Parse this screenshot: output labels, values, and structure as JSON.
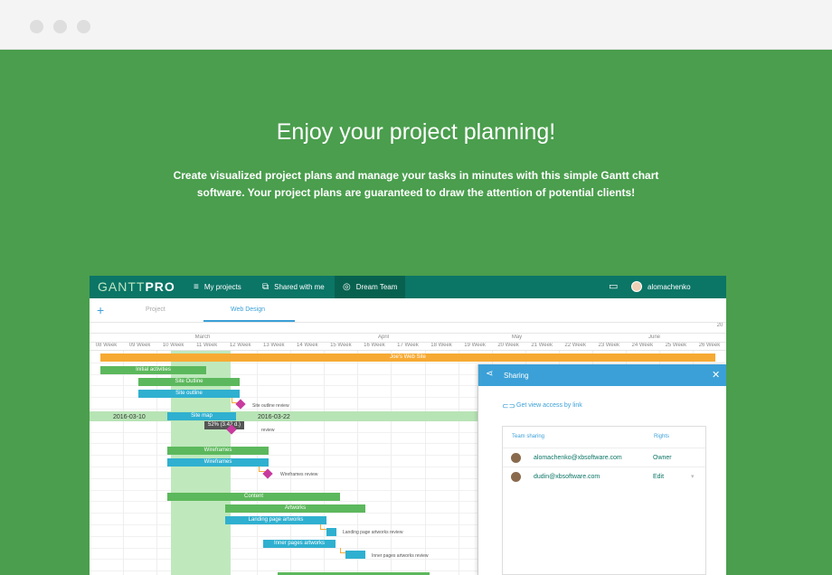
{
  "hero": {
    "title": "Enjoy your project planning!",
    "description": "Create visualized project plans and manage your tasks in minutes with this simple Gantt chart software. Your project plans are guaranteed to draw the attention of potential clients!"
  },
  "app": {
    "logo_part1": "GANTT",
    "logo_part2": "PRO",
    "nav": [
      {
        "label": "My projects",
        "icon": "list-icon"
      },
      {
        "label": "Shared with me",
        "icon": "share-edit-icon"
      },
      {
        "label": "Dream Team",
        "icon": "team-icon"
      }
    ],
    "username": "alomachenko",
    "tabs": [
      "Project",
      "Web Design"
    ],
    "months": [
      "March",
      "April",
      "May",
      "June"
    ],
    "weeks": [
      "08 Week",
      "09 Week",
      "10 Week",
      "11 Week",
      "12 Week",
      "13 Week",
      "14 Week",
      "15 Week",
      "16 Week",
      "17 Week",
      "18 Week",
      "19 Week",
      "20 Week",
      "21 Week",
      "22 Week",
      "23 Week",
      "24 Week",
      "25 Week",
      "26 Week"
    ],
    "top_right_num": "20",
    "tasks": {
      "joes_web_site": "Joe's Web Site",
      "initial_activities": "Initial activities",
      "site_outline_1": "Site Outline",
      "site_outline_2": "Site outline",
      "site_outline_review": "Site outline review",
      "site_map": "Site map",
      "site_map_review": "review",
      "start_date": "2016-03-10",
      "end_date": "2016-03-22",
      "tooltip": "52% (3.42 d.)",
      "wireframes_1": "Wireframes",
      "wireframes_2": "Wireframes",
      "wireframes_review": "Wireframes review",
      "content": "Content",
      "artworks": "Artworks",
      "landing_artworks": "Landing page artworks",
      "landing_artworks_review": "Landing page artworks review",
      "inner_artworks": "Inner pages artworks",
      "inner_artworks_review": "Inner pages artworks review"
    }
  },
  "sharing": {
    "title": "Sharing",
    "get_link": "Get view access by link",
    "col_team": "Team sharing",
    "col_rights": "Rights",
    "members": [
      {
        "email": "alomachenko@xbsoftware.com",
        "right": "Owner"
      },
      {
        "email": "dudin@xbsoftware.com",
        "right": "Edit"
      }
    ]
  },
  "colors": {
    "hero_green": "#4a9e4d",
    "topbar_teal": "#0b7566",
    "accent_blue": "#3ba0d7",
    "task_orange": "#f7aa33",
    "task_green": "#5cb85c",
    "task_blue": "#2fb0d0",
    "milestone": "#c83a9e"
  }
}
